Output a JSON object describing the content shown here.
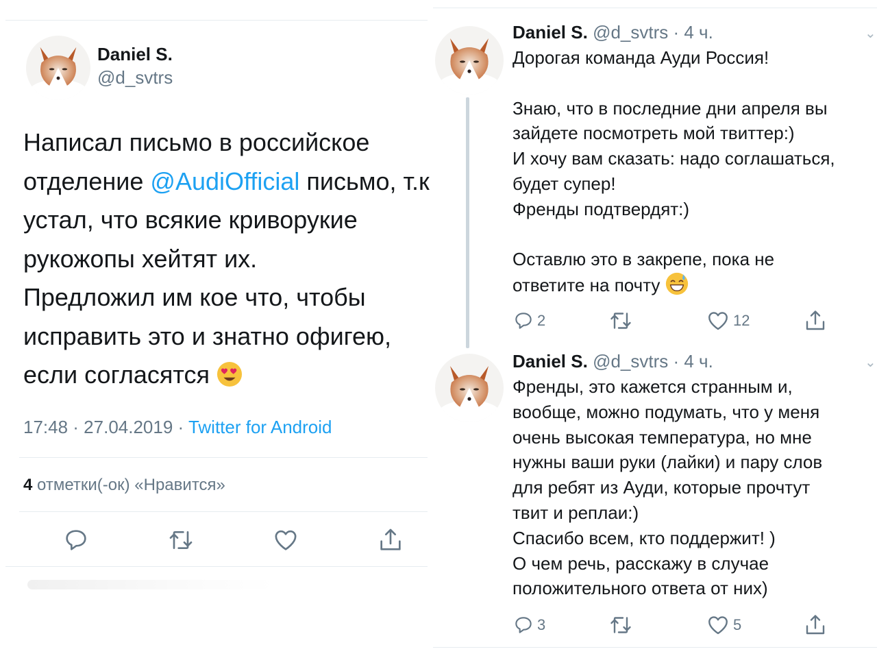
{
  "left_tweet": {
    "name": "Daniel S.",
    "handle": "@d_svtrs",
    "lines": [
      {
        "text": "Написал письмо в российское"
      },
      {
        "pre": "отделение ",
        "link": "@AudiOfficial",
        "post": " письмо, т.к"
      },
      {
        "text": "устал, что всякие криворукие"
      },
      {
        "text": "рукожопы хейтят их."
      },
      {
        "text": "Предложил им кое что, чтобы"
      },
      {
        "text": "исправить это и знатно офигею,"
      },
      {
        "text": "если согласятся"
      }
    ],
    "time": "17:48 · 27.04.2019 · ",
    "source": "Twitter for Android",
    "likes_count": "4",
    "likes_label": " отметки(-ок) «Нравится»",
    "actions": [
      "reply-icon",
      "retweet-icon",
      "like-icon",
      "share-icon"
    ],
    "emoji": "heart-eyes-emoji"
  },
  "right_tweets": [
    {
      "name": "Daniel S.",
      "handle": "@d_svtrs · 4 ч.",
      "lines": [
        "Дорогая команда Ауди Россия!",
        "",
        "Знаю, что в последние дни апреля вы",
        "зайдете посмотреть мой твиттер:)",
        "И хочу вам сказать: надо соглашаться,",
        "будет супер!",
        "Френды подтвердят:)",
        "",
        "Оставлю это в закрепе, пока не",
        "ответите на почту"
      ],
      "emoji": "sweat-smile-emoji",
      "replies": "2",
      "retweets": "",
      "likes": "12"
    },
    {
      "name": "Daniel S.",
      "handle": "@d_svtrs · 4 ч.",
      "lines": [
        "Френды, это кажется странным и,",
        "вообще, можно подумать, что у меня",
        "очень высокая температура, но мне",
        "нужны ваши руки (лайки) и пару слов",
        "для ребят из Ауди, которые прочтут",
        "твит и реплаи:)",
        "Спасибо всем, кто поддержит! )",
        "О чем речь, расскажу в случае",
        "положительного ответа от них)"
      ],
      "replies": "3",
      "retweets": "",
      "likes": "5"
    }
  ],
  "colors": {
    "link": "#1da1f2",
    "secondary": "#657786",
    "text": "#14171a",
    "divider": "#e6ecf0"
  }
}
